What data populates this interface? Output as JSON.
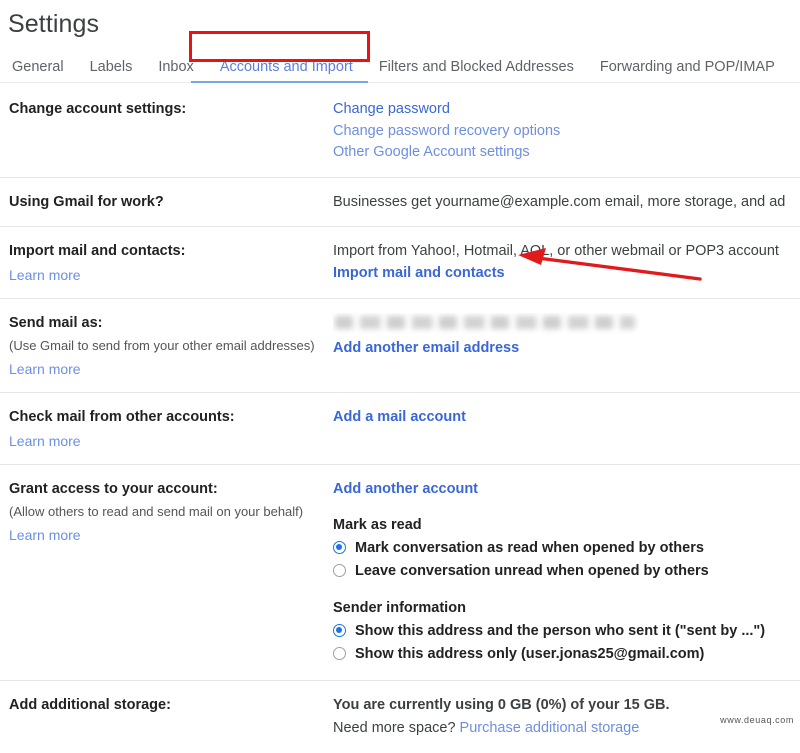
{
  "header": {
    "title": "Settings"
  },
  "tabs": [
    {
      "label": "General",
      "active": false
    },
    {
      "label": "Labels",
      "active": false
    },
    {
      "label": "Inbox",
      "active": false
    },
    {
      "label": "Accounts and Import",
      "active": true
    },
    {
      "label": "Filters and Blocked Addresses",
      "active": false
    },
    {
      "label": "Forwarding and POP/IMAP",
      "active": false
    }
  ],
  "annotations": {
    "tab_highlight_color": "#ee1111",
    "arrow_color": "#e01b1b",
    "arrow_points_to": "Import mail and contacts"
  },
  "sections": {
    "change_account": {
      "label": "Change account settings:",
      "links": [
        "Change password",
        "Change password recovery options",
        "Other Google Account settings"
      ]
    },
    "gmail_for_work": {
      "label": "Using Gmail for work?",
      "text": "Businesses get yourname@example.com email, more storage, and ad"
    },
    "import_mail": {
      "label": "Import mail and contacts:",
      "learn_more": "Learn more",
      "text": "Import from Yahoo!, Hotmail, AOL, or other webmail or POP3 account",
      "link": "Import mail and contacts"
    },
    "send_mail_as": {
      "label": "Send mail as:",
      "sub": "(Use Gmail to send from your other email addresses)",
      "learn_more": "Learn more",
      "redacted_value": "",
      "link": "Add another email address"
    },
    "check_mail": {
      "label": "Check mail from other accounts:",
      "learn_more": "Learn more",
      "link": "Add a mail account"
    },
    "grant_access": {
      "label": "Grant access to your account:",
      "sub": "(Allow others to read and send mail on your behalf)",
      "learn_more": "Learn more",
      "link": "Add another account",
      "mark_as_read": {
        "title": "Mark as read",
        "options": [
          {
            "label": "Mark conversation as read when opened by others",
            "selected": true
          },
          {
            "label": "Leave conversation unread when opened by others",
            "selected": false
          }
        ]
      },
      "sender_information": {
        "title": "Sender information",
        "options": [
          {
            "label": "Show this address and the person who sent it (\"sent by ...\")",
            "selected": true
          },
          {
            "label": "Show this address only (user.jonas25@gmail.com)",
            "selected": false
          }
        ]
      }
    },
    "storage": {
      "label": "Add additional storage:",
      "usage": "You are currently using 0 GB (0%) of your 15 GB.",
      "need_more_prefix": "Need more space? ",
      "purchase_link": "Purchase additional storage"
    }
  },
  "watermark": "www.deuaq.com"
}
